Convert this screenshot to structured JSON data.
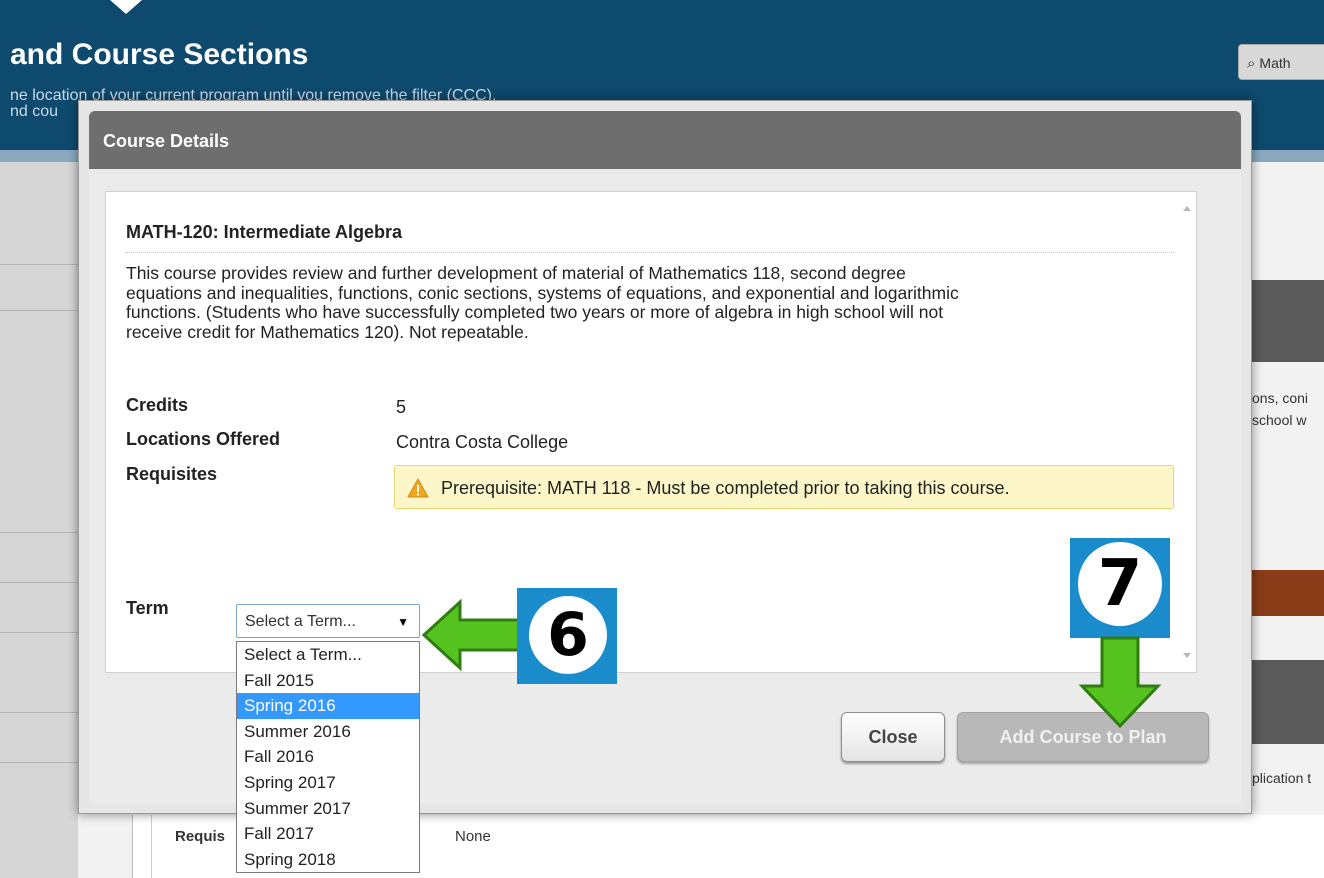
{
  "background": {
    "page_title": "and Course Sections",
    "filter_note_line1": "ne location of your current program until you remove the filter (CCC).",
    "filter_note_line2": "nd cou",
    "search_chip": "Math",
    "right_snippet_1": "ons, coni",
    "right_snippet_2": "school w",
    "right_snippet_3": "plication t",
    "bottom_req_label": "Requis",
    "bottom_req_value": "None"
  },
  "modal": {
    "title": "Course Details",
    "course_title": "MATH-120: Intermediate Algebra",
    "description_lines": [
      "This course provides review and further development of material of Mathematics 118, second degree",
      "equations and inequalities, functions, conic sections, systems of equations, and exponential and logarithmic",
      "functions. (Students who have successfully completed two years or more of algebra in high school will not",
      "receive credit for Mathematics 120). Not repeatable."
    ],
    "credits_label": "Credits",
    "credits_value": "5",
    "locations_label": "Locations Offered",
    "locations_value": "Contra Costa College",
    "requisites_label": "Requisites",
    "prerequisite_text": "Prerequisite: MATH 118 - Must be completed prior to taking this course.",
    "term_label": "Term",
    "term_select_value": "Select a Term...",
    "term_options": [
      "Select a Term...",
      "Fall 2015",
      "Spring 2016",
      "Summer 2016",
      "Fall 2016",
      "Spring 2017",
      "Summer 2017",
      "Fall 2017",
      "Spring 2018"
    ],
    "highlighted_option": "Spring 2016",
    "close_button": "Close",
    "add_button": "Add Course to Plan"
  },
  "annotations": {
    "step_six": "6",
    "step_seven": "7",
    "arrow_color": "#56c21f",
    "badge_color": "#1a8ccc"
  },
  "colors": {
    "header_bg": "#0e4a6e",
    "modal_header_bg": "#6e6e6e",
    "select_highlight": "#3399ff",
    "prereq_bg": "#fdf6c8"
  }
}
